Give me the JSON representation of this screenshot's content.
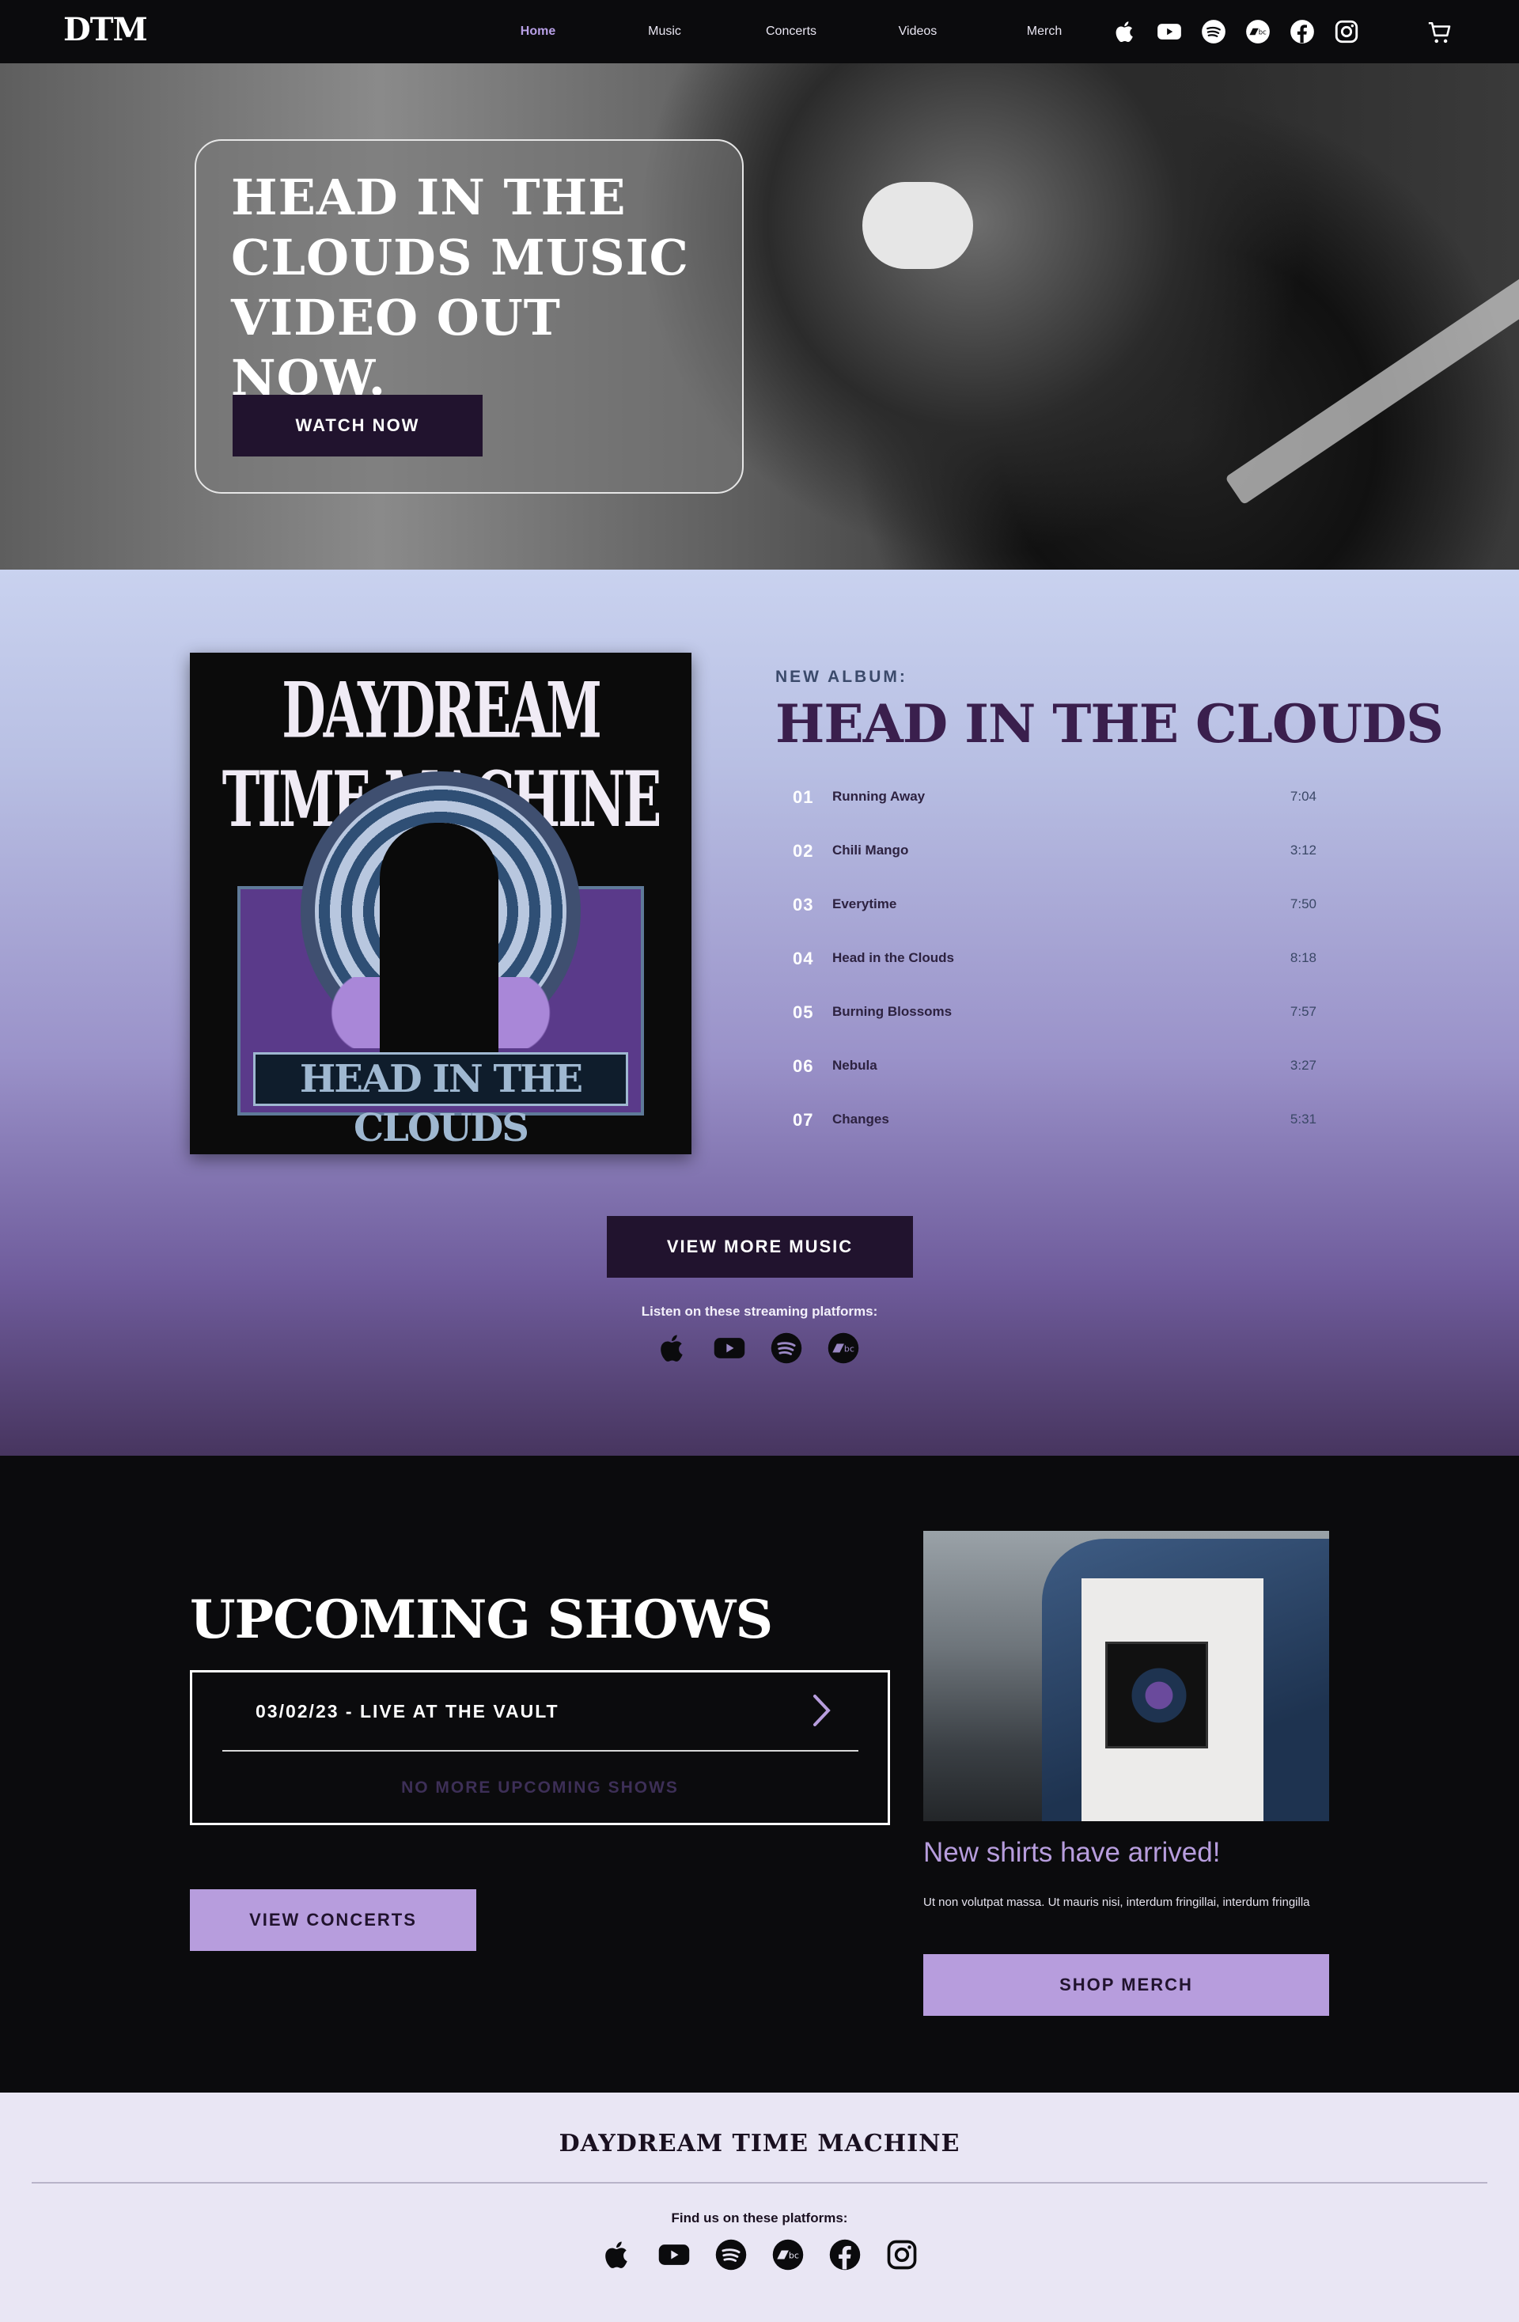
{
  "nav": {
    "logo": "DTM",
    "links": [
      {
        "label": "Home",
        "active": true
      },
      {
        "label": "Music",
        "active": false
      },
      {
        "label": "Concerts",
        "active": false
      },
      {
        "label": "Videos",
        "active": false
      },
      {
        "label": "Merch",
        "active": false
      }
    ],
    "social_icons": [
      "apple-icon",
      "youtube-icon",
      "spotify-icon",
      "bandcamp-icon",
      "facebook-icon",
      "instagram-icon"
    ],
    "cart_icon": "cart-icon"
  },
  "hero": {
    "title": "Head in the clouds music video out now.",
    "button": "WATCH NOW"
  },
  "album": {
    "cover_title": "DAYDREAM TIME MACHINE",
    "cover_subtitle": "HEAD IN THE CLOUDS",
    "kicker": "NEW ALBUM:",
    "title": "HEAD IN THE CLOUDS",
    "tracks": [
      {
        "num": "01",
        "name": "Running Away",
        "time": "7:04"
      },
      {
        "num": "02",
        "name": "Chili Mango",
        "time": "3:12"
      },
      {
        "num": "03",
        "name": "Everytime",
        "time": "7:50"
      },
      {
        "num": "04",
        "name": "Head in the Clouds",
        "time": "8:18"
      },
      {
        "num": "05",
        "name": "Burning Blossoms",
        "time": "7:57"
      },
      {
        "num": "06",
        "name": "Nebula",
        "time": "3:27"
      },
      {
        "num": "07",
        "name": "Changes",
        "time": "5:31"
      }
    ],
    "button": "VIEW MORE MUSIC",
    "listen_label": "Listen on these streaming platforms:",
    "stream_icons": [
      "apple-icon",
      "youtube-icon",
      "spotify-icon",
      "bandcamp-icon"
    ]
  },
  "shows": {
    "title": "UPCOMING SHOWS",
    "items": [
      {
        "label": "03/02/23 - LIVE AT THE VAULT"
      }
    ],
    "no_more": "NO MORE UPCOMING SHOWS",
    "button": "VIEW CONCERTS"
  },
  "merch": {
    "title": "New shirts have arrived!",
    "text": "Ut non volutpat massa. Ut mauris nisi, interdum fringillai, interdum fringilla",
    "button": "SHOP MERCH"
  },
  "footer": {
    "name": "DAYDREAM TIME MACHINE",
    "label": "Find us on these platforms:",
    "icons": [
      "apple-icon",
      "youtube-icon",
      "spotify-icon",
      "bandcamp-icon",
      "facebook-icon",
      "instagram-icon"
    ]
  },
  "colors": {
    "accent": "#b79ddd",
    "dark_button": "#21132e",
    "page_dark": "#0b0b0d",
    "footer_bg": "#e9e6f4"
  }
}
